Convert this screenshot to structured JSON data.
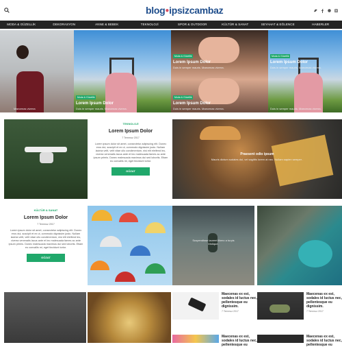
{
  "logo": {
    "part1": "blog",
    "part2": "ipsizcambaz"
  },
  "nav": [
    "MODA & GÜZELLİK",
    "DEKORASYON",
    "ANNE & BEBEK",
    "TEKNOLOJİ",
    "SPOR & OUTDOOR",
    "KÜLTÜR & SANAT",
    "SEYAHAT & EĞLENCE",
    "HABERLER"
  ],
  "hero": [
    {
      "badge": "",
      "title": "",
      "text": "Maecenas viverra"
    },
    {
      "badge": "Moda & Güzellik",
      "title": "Lorem Ipsum Dolor",
      "text": "Duis in semper mauris. Maecenas viverra."
    },
    {
      "badge": "Moda & Güzellik",
      "title": "Lorem Ipsum Dolor",
      "text": "Duis in semper mauris. Maecenas viverra."
    },
    {
      "badge": "Moda & Güzellik",
      "title": "Lorem Ipsum Dolor",
      "text": "Duis in semper mauris. Maecenas viverra."
    },
    {
      "badge": "Moda & Güzellik",
      "title": "Lorem Ipsum Dolor",
      "text": "Duis in semper mauris. Maecenas viverra."
    },
    {
      "badge": "",
      "title": "",
      "text": "Duis in semper mauris. Maecenas viverra."
    }
  ],
  "card1": {
    "category": "TEKNOLOJİ",
    "title": "Lorem Ipsum Dolor",
    "date": "7 Temmuz 2017",
    "excerpt": "Lorem ipsum dolor sit amet, consectetur adipiscing elit. Donec eros dui, suscipit et ex ut, commodo dignissim justo. Nullam lacinia velit, velit vitae ullo condimentum, nisi elit eleifend leo, viverra venenatis lacus ante et leo malesuada fames ac ante ipsum primis. Donec malesuada maximus dui sed lobortis. Etiam eu convallis mi, eget tincidunt tortor.",
    "button": "GÖZAT"
  },
  "burger": {
    "title": "Praesent odio ipsum",
    "text": "Mauris dictum sodales dui, vel sagittis lorem at nec. Nullam sapien semper ."
  },
  "card2": {
    "category": "KÜLTÜR & SANAT",
    "title": "Lorem Ipsum Dolor",
    "date": "7 Temmuz 2017",
    "excerpt": "Lorem ipsum dolor sit amet, consectetur adipiscing elit. Donec eros dui, suscipit et ex ut, commodo dignissim justo. Nullam lacinia velit, velit vitae ullo condimentum, nisi elit eleifend leo, viverra venenatis lacus ante et leo malesuada fames ac ante ipsum primis. Donec malesuada maximus dui sed lobortis. Etiam eu convallis mi, eget tincidunt tortor.",
    "button": "GÖZAT"
  },
  "hiker": {
    "text": "Suspendisse laoreet libero a turpis tristique."
  },
  "side": [
    {
      "title": "Maecenas ex est, sodales id luctus nec, pellentesque eu dignissim.",
      "date": "7 Temmuz 2017"
    },
    {
      "title": "Maecenas ex est, sodales id luctus nec, pellentesque eu dignissim.",
      "date": "7 Temmuz 2017"
    },
    {
      "title": "Maecenas ex est, sodales id luctus nec, pellentesque eu",
      "date": ""
    },
    {
      "title": "Maecenas ex est, sodales id luctus nec, pellentesque eu",
      "date": ""
    }
  ],
  "colors": {
    "accent": "#20a86b",
    "nav_bg": "#242424",
    "logo": "#1f4e8c"
  }
}
